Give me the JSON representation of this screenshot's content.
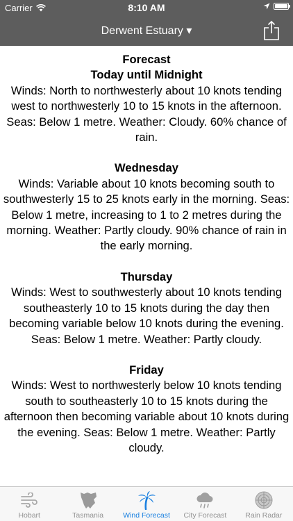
{
  "status_bar": {
    "carrier": "Carrier",
    "time": "8:10 AM"
  },
  "nav": {
    "title": "Derwent Estuary ▾"
  },
  "forecast": {
    "heading": "Forecast",
    "period": "Today until Midnight",
    "today_text": "Winds: North to northwesterly about 10 knots tending west to northwesterly 10 to 15 knots in the afternoon. Seas: Below 1 metre. Weather: Cloudy. 60% chance of rain.",
    "days": [
      {
        "title": "Wednesday",
        "text": "Winds: Variable about 10 knots becoming south to southwesterly 15 to 25 knots early in the morning. Seas: Below 1 metre, increasing to 1 to 2 metres during the morning. Weather: Partly cloudy. 90% chance of rain in the early morning."
      },
      {
        "title": "Thursday",
        "text": "Winds: West to southwesterly about 10 knots tending southeasterly 10 to 15 knots during the day then becoming variable below 10 knots during the evening. Seas: Below 1 metre. Weather: Partly cloudy."
      },
      {
        "title": "Friday",
        "text": "Winds: West to northwesterly below 10 knots tending south to southeasterly 10 to 15 knots during the afternoon then becoming variable about 10 knots during the evening. Seas: Below 1 metre. Weather: Partly cloudy."
      }
    ]
  },
  "tabs": [
    {
      "label": "Hobart",
      "icon": "wind-icon"
    },
    {
      "label": "Tasmania",
      "icon": "tasmania-map-icon"
    },
    {
      "label": "Wind Forecast",
      "icon": "palm-tree-icon",
      "active": true
    },
    {
      "label": "City Forecast",
      "icon": "cloud-rain-icon"
    },
    {
      "label": "Rain Radar",
      "icon": "radar-icon"
    }
  ],
  "colors": {
    "header": "#5d5d5d",
    "active_tab": "#1a80e0",
    "inactive_tab": "#929292"
  }
}
